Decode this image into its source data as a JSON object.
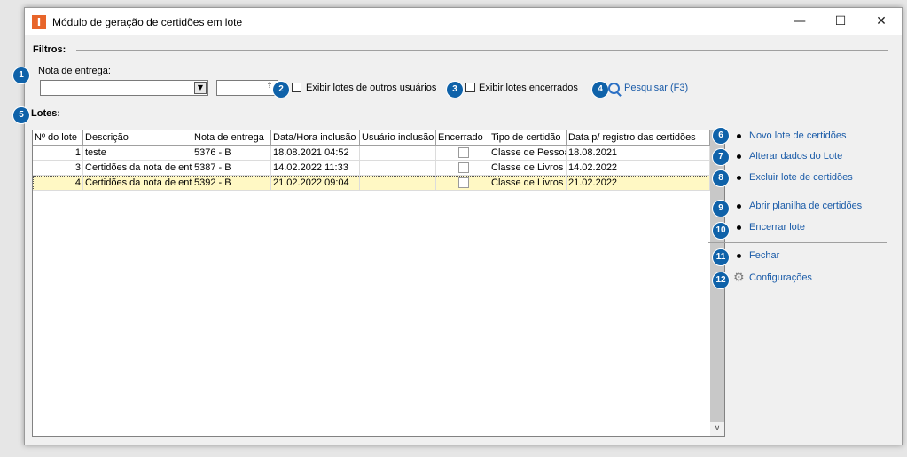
{
  "window": {
    "title": "Módulo de geração de certidões em lote",
    "app_icon": "I",
    "minimize_glyph": "—",
    "maximize_glyph": "☐",
    "close_glyph": "✕"
  },
  "filters": {
    "section_label": "Filtros:",
    "nota_label": "Nota de entrega:",
    "nota_value": "",
    "number_value": "",
    "show_other_users_label": "Exibir lotes de outros usuários",
    "show_closed_label": "Exibir lotes encerrados",
    "search_label": "Pesquisar (F3)"
  },
  "lotes": {
    "section_label": "Lotes:",
    "columns": [
      "Nº do lote",
      "Descrição",
      "Nota de entrega",
      "Data/Hora inclusão",
      "Usuário inclusão",
      "Encerrado",
      "Tipo de certidão",
      "Data p/ registro das certidões"
    ],
    "rows": [
      {
        "num": "1",
        "descricao": "teste",
        "nota": "5376 - B",
        "data_hora": "18.08.2021 04:52",
        "usuario": "",
        "encerrado": false,
        "tipo": "Classe de Pessoa",
        "data_registro": "18.08.2021"
      },
      {
        "num": "3",
        "descricao": "Certidões da nota de ent",
        "nota": "5387 - B",
        "data_hora": "14.02.2022 11:33",
        "usuario": "",
        "encerrado": false,
        "tipo": "Classe de Livros",
        "data_registro": "14.02.2022"
      },
      {
        "num": "4",
        "descricao": "Certidões da nota de ent",
        "nota": "5392 - B",
        "data_hora": "21.02.2022 09:04",
        "usuario": "",
        "encerrado": false,
        "tipo": "Classe de Livros",
        "data_registro": "21.02.2022"
      }
    ]
  },
  "actions": {
    "novo": "Novo lote de certidões",
    "alterar": "Alterar dados do Lote",
    "excluir": "Excluir lote de certidões",
    "abrir": "Abrir planilha de certidões",
    "encerrar": "Encerrar lote",
    "fechar": "Fechar",
    "configuracoes": "Configurações"
  },
  "badges": [
    "1",
    "2",
    "3",
    "4",
    "5",
    "6",
    "7",
    "8",
    "9",
    "10",
    "11",
    "12"
  ],
  "colors": {
    "badge": "#0f62a9",
    "link": "#1a5ba8",
    "selected_row": "#fff8c4",
    "app_icon": "#e8652a"
  }
}
